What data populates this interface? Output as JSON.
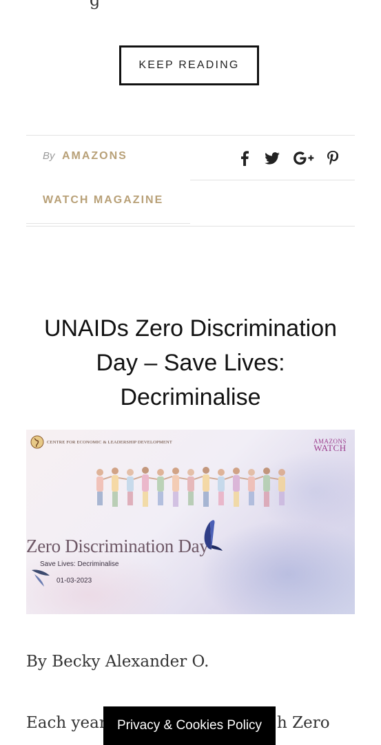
{
  "previous_post": {
    "text_fragment": "g",
    "keep_reading_label": "KEEP READING"
  },
  "meta": {
    "by_word": "By",
    "author_line1": "AMAZONS",
    "author_line2": "WATCH MAGAZINE"
  },
  "share": {
    "icons": [
      "facebook-icon",
      "twitter-icon",
      "google-plus-icon",
      "pinterest-icon"
    ]
  },
  "post": {
    "title": "UNAIDs Zero Discrimination Day – Save Lives: Decriminalise",
    "image": {
      "org_name": "CENTRE FOR ECONOMIC & LEADERSHIP DEVELOPMENT",
      "brand_line1": "AMAZONS",
      "brand_line2": "WATCH",
      "event_title": "Zero Discrimination Day",
      "tagline": "Save Lives: Decriminalise",
      "date": "01-03-2023"
    },
    "byline": "By Becky Alexander O.",
    "paragraph_start": "Each year",
    "paragraph_end": "h Zero"
  },
  "cookie_bar": {
    "label": "Privacy & Cookies Policy"
  },
  "colors": {
    "accent": "#b8a077",
    "cookie_bg": "#000000",
    "brand_purple": "#9b3c8c"
  }
}
